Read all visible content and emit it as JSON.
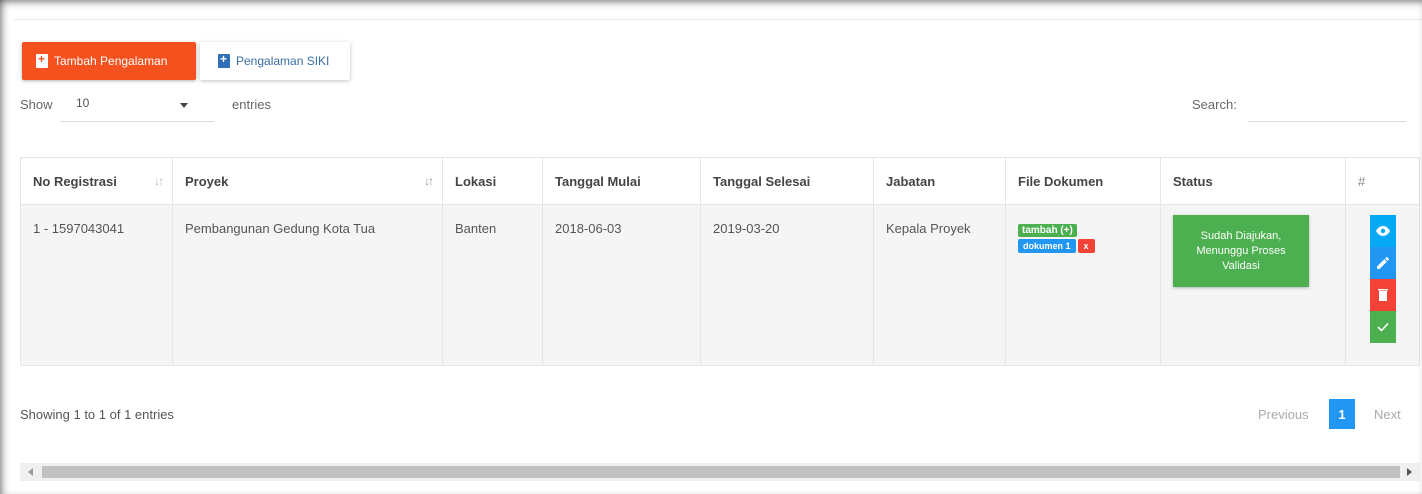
{
  "toolbar": {
    "add_label": "Tambah Pengalaman",
    "siki_label": "Pengalaman SIKI"
  },
  "length": {
    "show_label": "Show",
    "value": "10",
    "entries_label": "entries"
  },
  "search": {
    "label": "Search:",
    "value": ""
  },
  "table": {
    "headers": [
      "No Registrasi",
      "Proyek",
      "Lokasi",
      "Tanggal Mulai",
      "Tanggal Selesai",
      "Jabatan",
      "File Dokumen",
      "Status",
      "#"
    ],
    "rows": [
      {
        "no_registrasi": "1 - 1597043041",
        "proyek": "Pembangunan Gedung Kota Tua",
        "lokasi": "Banten",
        "tanggal_mulai": "2018-06-03",
        "tanggal_selesai": "2019-03-20",
        "jabatan": "Kepala Proyek",
        "file_add_label": "tambah (+)",
        "file_doc_label": "dokumen 1",
        "file_remove_label": "x",
        "status": "Sudah Diajukan, Menunggu Proses Validasi"
      }
    ]
  },
  "footer": {
    "info": "Showing 1 to 1 of 1 entries",
    "previous": "Previous",
    "current_page": "1",
    "next": "Next"
  },
  "icons": {
    "add": "file-plus-icon",
    "view": "eye-icon",
    "edit": "pencil-icon",
    "delete": "trash-icon",
    "approve": "check-icon"
  },
  "colors": {
    "primary_orange": "#f4511e",
    "green": "#4caf50",
    "blue": "#2196f3",
    "light_blue": "#03a9f4",
    "red": "#f44336"
  }
}
